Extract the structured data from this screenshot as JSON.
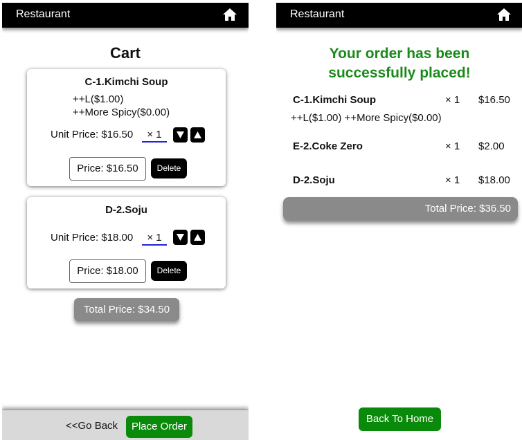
{
  "cart_screen": {
    "header": {
      "title": "Restaurant"
    },
    "page_title": "Cart",
    "items": [
      {
        "name": "C-1.Kimchi Soup",
        "options": [
          "++L($1.00)",
          "++More Spicy($0.00)"
        ],
        "unit_price_label": "Unit Price: $16.50",
        "quantity": "× 1",
        "price_label": "Price: $16.50",
        "delete_label": "Delete"
      },
      {
        "name": "D-2.Soju",
        "options": [],
        "unit_price_label": "Unit Price: $18.00",
        "quantity": "× 1",
        "price_label": "Price: $18.00",
        "delete_label": "Delete"
      }
    ],
    "total_label": "Total Price: $34.50",
    "footer": {
      "go_back_label": "<<Go Back",
      "place_order_label": "Place Order"
    }
  },
  "confirmation_screen": {
    "header": {
      "title": "Restaurant"
    },
    "message": [
      "Your order has been",
      "successfully placed!"
    ],
    "orders": [
      {
        "name": "C-1.Kimchi Soup",
        "qty": "× 1",
        "price": "$16.50",
        "options": "++L($1.00) ++More Spicy($0.00)"
      },
      {
        "name": "E-2.Coke Zero",
        "qty": "× 1",
        "price": "$2.00"
      },
      {
        "name": "D-2.Soju",
        "qty": "× 1",
        "price": "$18.00"
      }
    ],
    "total_label": "Total Price: $36.50",
    "back_home_label": "Back To Home"
  },
  "colors": {
    "header_bg": "#000000",
    "success_green": "#1a8a1a",
    "button_green": "#0a8a0a",
    "total_gray": "#8a8a8a",
    "qty_underline": "#2222dd"
  },
  "icons": {
    "home": "home-icon",
    "decrease": "triangle-down-icon",
    "increase": "triangle-up-icon"
  }
}
